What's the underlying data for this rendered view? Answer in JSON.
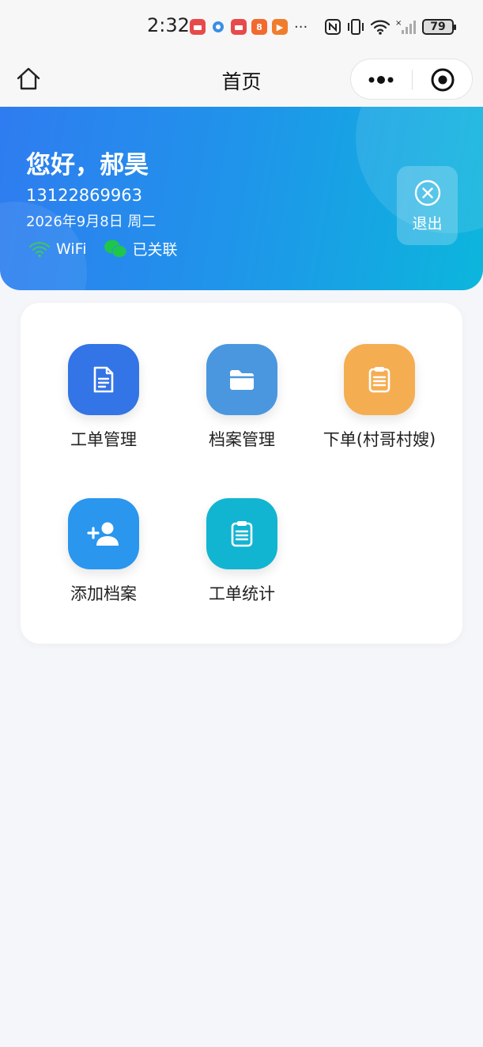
{
  "status_bar": {
    "time": "2:32",
    "more": "···",
    "battery": "79",
    "app_icons": [
      {
        "name": "huawei-mall-icon",
        "color": "#e84a4a",
        "glyph": ""
      },
      {
        "name": "browser-icon",
        "color": "#3a8ee6",
        "glyph": ""
      },
      {
        "name": "huawei-mall-icon-2",
        "color": "#e84a4a",
        "glyph": ""
      },
      {
        "name": "app-orange-icon",
        "color": "#f26a2e",
        "glyph": "8"
      },
      {
        "name": "video-play-icon",
        "color": "#f07d2c",
        "glyph": "▶"
      }
    ]
  },
  "nav": {
    "title": "首页"
  },
  "header": {
    "greeting": "您好，郝昊",
    "phone": "13122869963",
    "date": "2026年9月8日 周二",
    "wifi_label": "WiFi",
    "wechat_label": "已关联",
    "logout_label": "退出",
    "gradient_colors": [
      "#2f7cf0",
      "#0cb6dc"
    ]
  },
  "menu": {
    "items": [
      {
        "label": "工单管理",
        "icon": "document-icon",
        "color": "#3374e6"
      },
      {
        "label": "档案管理",
        "icon": "folder-icon",
        "color": "#4a97e0"
      },
      {
        "label": "下单(村哥村嫂)",
        "icon": "clipboard-icon",
        "color": "#f5ad52"
      },
      {
        "label": "添加档案",
        "icon": "add-user-icon",
        "color": "#2a96ee"
      },
      {
        "label": "工单统计",
        "icon": "statistics-clipboard-icon",
        "color": "#12b5d1"
      }
    ]
  }
}
